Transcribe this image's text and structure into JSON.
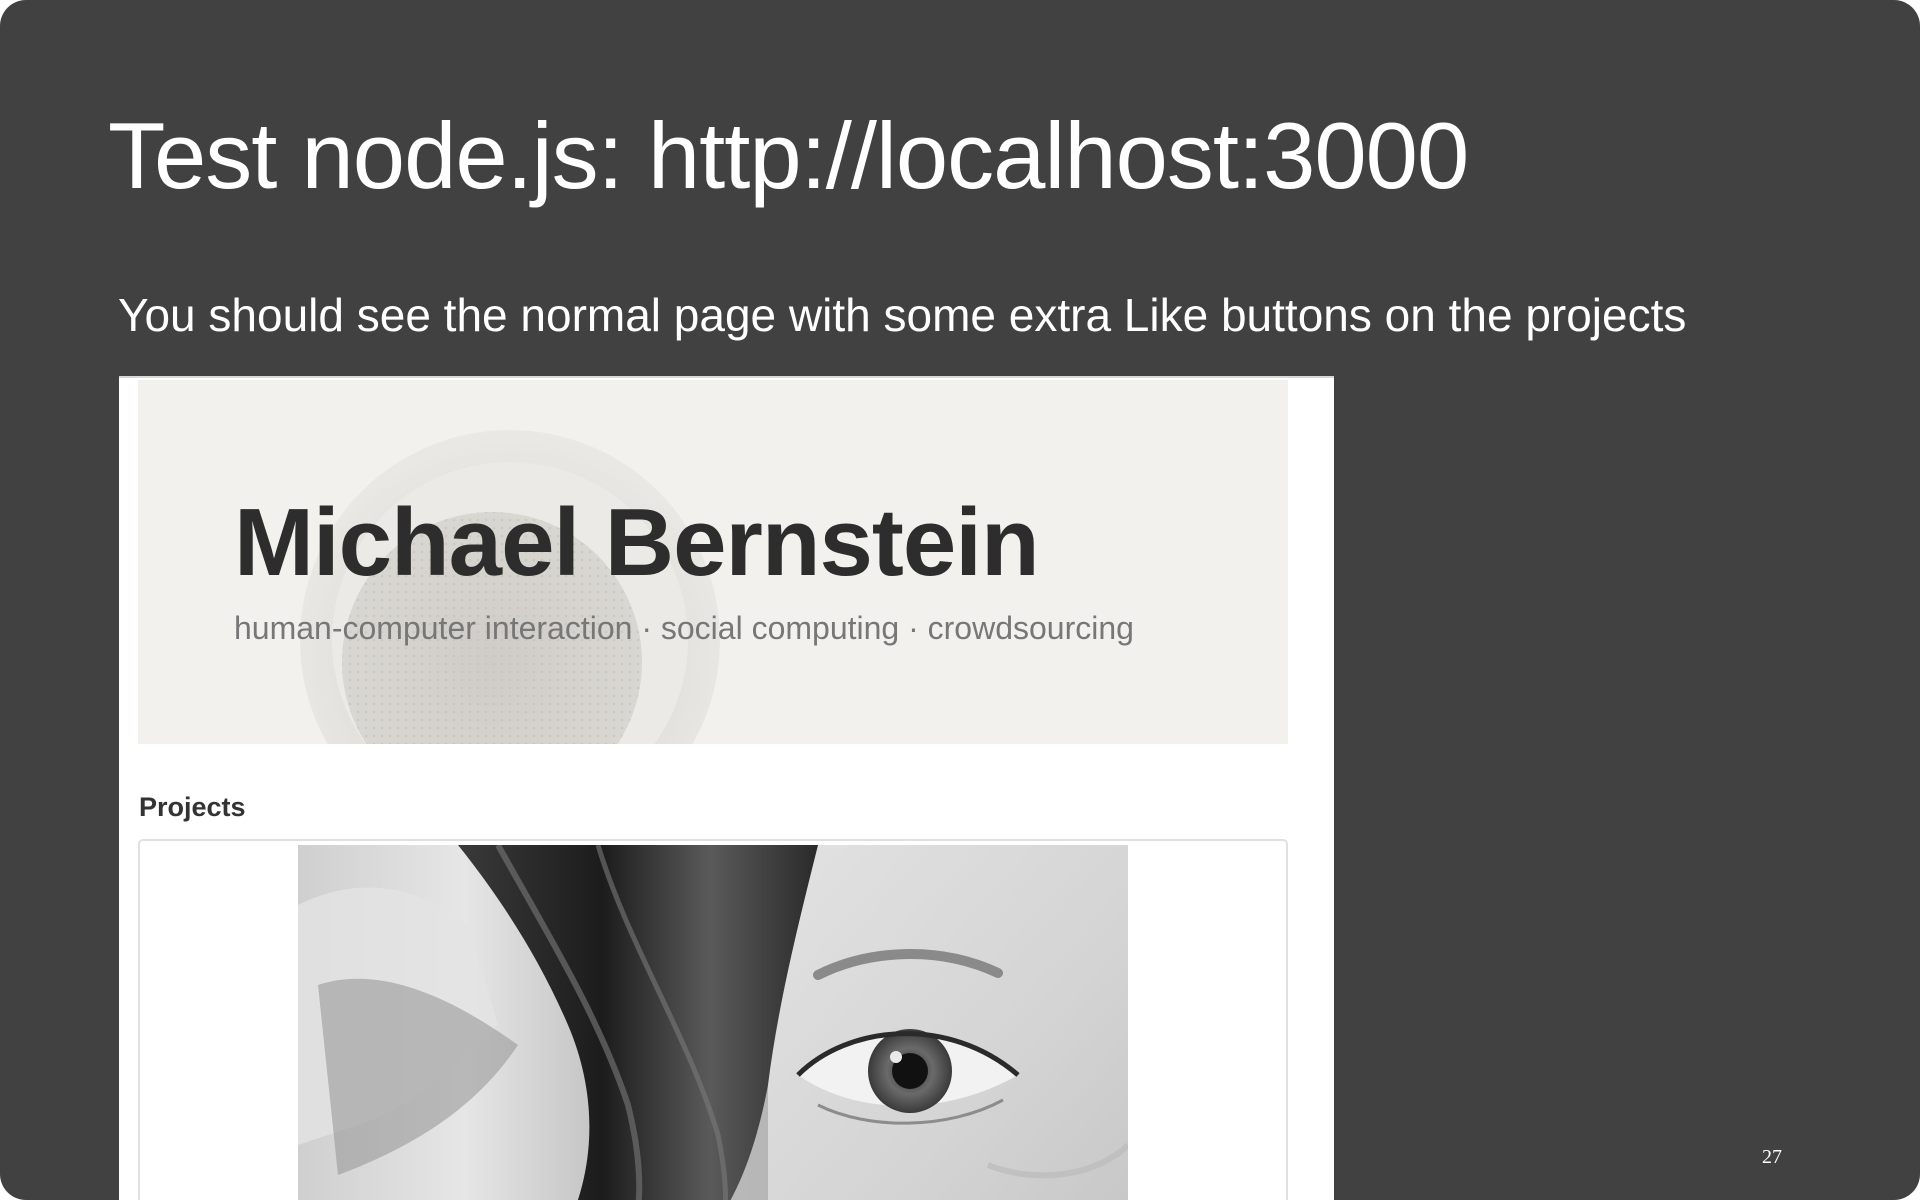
{
  "slide": {
    "title": "Test node.js: http://localhost:3000",
    "subtitle": "You should see the normal page with some extra Like buttons on the projects",
    "page_number": "27",
    "background_color": "#414141",
    "text_color": "#ffffff"
  },
  "screenshot": {
    "hero": {
      "name": "Michael Bernstein",
      "tagline": "human-computer interaction · social computing · crowdsourcing",
      "background_icon": "speaker-photo"
    },
    "projects": {
      "heading": "Projects",
      "items": [
        {
          "image_icon": "eye-photo"
        }
      ]
    }
  }
}
